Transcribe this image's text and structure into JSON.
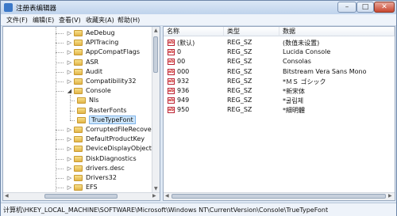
{
  "window": {
    "title": "注册表编辑器",
    "buttons": {
      "minimize": "–",
      "maximize": "□",
      "close": "✕"
    }
  },
  "menu": [
    "文件(F)",
    "编辑(E)",
    "查看(V)",
    "收藏夹(A)",
    "帮助(H)"
  ],
  "tree": {
    "items": [
      {
        "label": "AeDebug",
        "expandable": true
      },
      {
        "label": "APITracing",
        "expandable": true
      },
      {
        "label": "AppCompatFlags",
        "expandable": true
      },
      {
        "label": "ASR",
        "expandable": true
      },
      {
        "label": "Audit",
        "expandable": true
      },
      {
        "label": "Compatibility32",
        "expandable": true
      },
      {
        "label": "Console",
        "expandable": true,
        "expanded": true
      },
      {
        "label": "Nls",
        "child": true
      },
      {
        "label": "RasterFonts",
        "child": true
      },
      {
        "label": "TrueTypeFont",
        "child": true,
        "selected": true
      },
      {
        "label": "CorruptedFileRecovery",
        "expandable": true
      },
      {
        "label": "DefaultProductKey",
        "expandable": true
      },
      {
        "label": "DeviceDisplayObjects",
        "expandable": true
      },
      {
        "label": "DiskDiagnostics",
        "expandable": true
      },
      {
        "label": "drivers.desc",
        "expandable": true
      },
      {
        "label": "Drivers32",
        "expandable": true
      },
      {
        "label": "EFS",
        "expandable": true
      }
    ]
  },
  "values": {
    "columns": {
      "name": "名称",
      "type": "类型",
      "data": "数据"
    },
    "rows": [
      {
        "name": "(默认)",
        "type": "REG_SZ",
        "data": "(数值未设置)"
      },
      {
        "name": "0",
        "type": "REG_SZ",
        "data": "Lucida Console"
      },
      {
        "name": "00",
        "type": "REG_SZ",
        "data": "Consolas"
      },
      {
        "name": "000",
        "type": "REG_SZ",
        "data": "Bitstream Vera Sans Mono"
      },
      {
        "name": "932",
        "type": "REG_SZ",
        "data": "*ＭＳ ゴシック"
      },
      {
        "name": "936",
        "type": "REG_SZ",
        "data": "*新宋体"
      },
      {
        "name": "949",
        "type": "REG_SZ",
        "data": "*굴림체"
      },
      {
        "name": "950",
        "type": "REG_SZ",
        "data": "*細明體"
      }
    ],
    "icon_text": "ab"
  },
  "status": "计算机\\HKEY_LOCAL_MACHINE\\SOFTWARE\\Microsoft\\Windows NT\\CurrentVersion\\Console\\TrueTypeFont",
  "colors": {
    "selection": "#cde6fb",
    "folder": "#e8c15a",
    "title_bar": "#c9d9ef"
  }
}
